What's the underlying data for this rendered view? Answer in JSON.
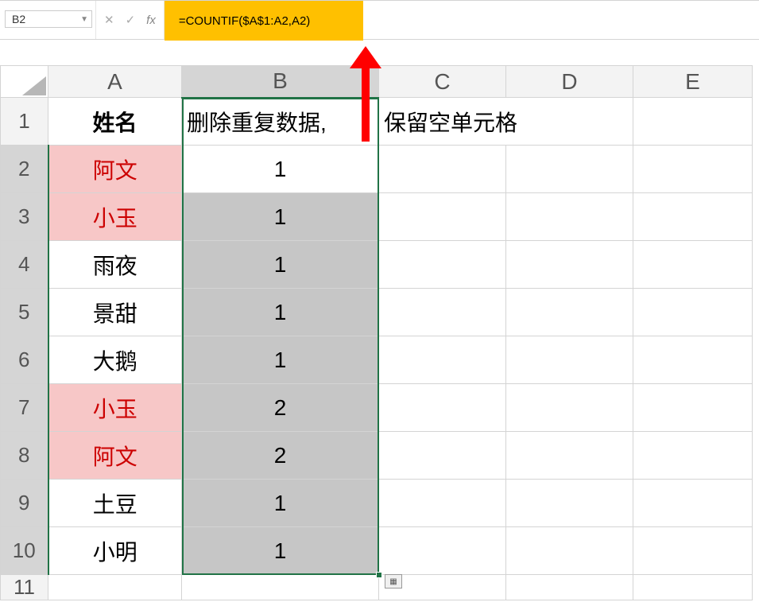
{
  "formula_bar": {
    "cell_ref": "B2",
    "cancel_icon": "✕",
    "enter_icon": "✓",
    "fx_label": "fx",
    "formula": "=COUNTIF($A$1:A2,A2)"
  },
  "columns": [
    "A",
    "B",
    "C",
    "D",
    "E"
  ],
  "row_numbers": [
    "1",
    "2",
    "3",
    "4",
    "5",
    "6",
    "7",
    "8",
    "9",
    "10",
    "11"
  ],
  "header_row": {
    "A": "姓名",
    "B": "删除重复数据,",
    "C": "保留空单元格",
    "D": "",
    "E": ""
  },
  "rows": [
    {
      "name": "阿文",
      "count": "1",
      "highlight": true
    },
    {
      "name": "小玉",
      "count": "1",
      "highlight": true
    },
    {
      "name": "雨夜",
      "count": "1",
      "highlight": false
    },
    {
      "name": "景甜",
      "count": "1",
      "highlight": false
    },
    {
      "name": "大鹅",
      "count": "1",
      "highlight": false
    },
    {
      "name": "小玉",
      "count": "2",
      "highlight": true
    },
    {
      "name": "阿文",
      "count": "2",
      "highlight": true
    },
    {
      "name": "土豆",
      "count": "1",
      "highlight": false
    },
    {
      "name": "小明",
      "count": "1",
      "highlight": false
    }
  ],
  "autofill_icon": "▦"
}
